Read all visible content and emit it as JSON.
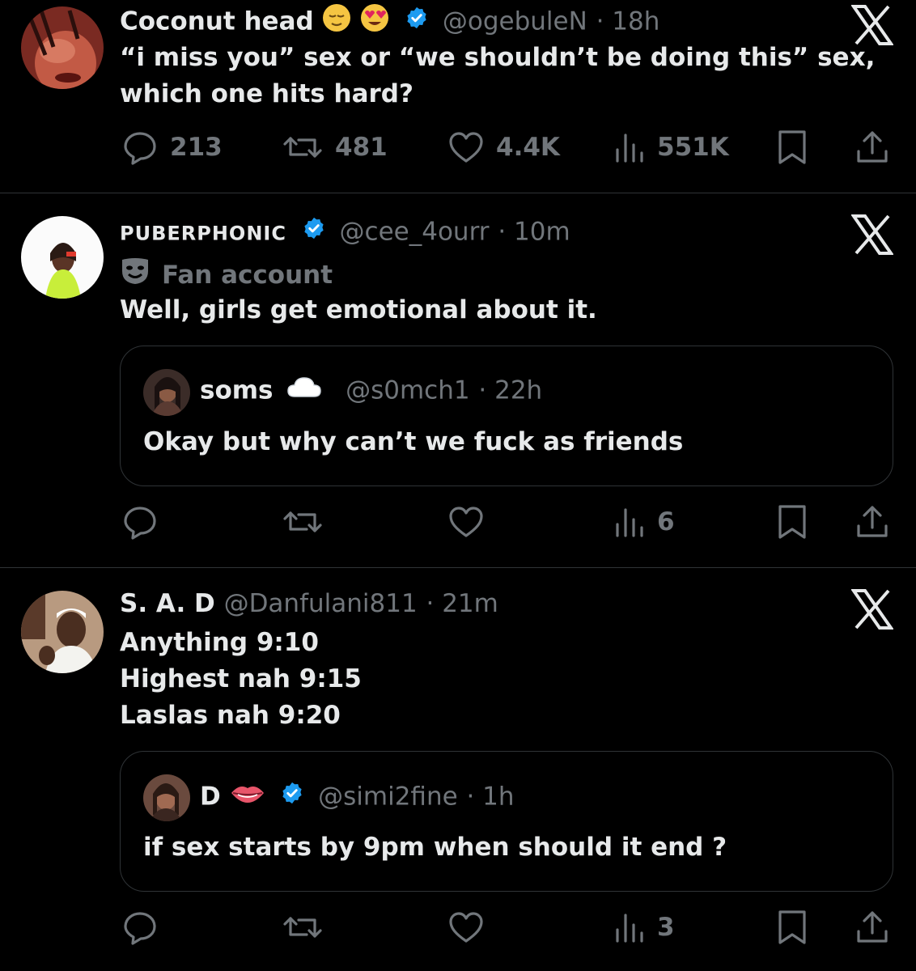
{
  "tweets": [
    {
      "name": "Coconut head",
      "handle": "@ogebuleN",
      "time": "· 18h",
      "lines": [
        "“i miss you” sex or “we shouldn’t be doing this” sex,",
        "which one hits hard?"
      ],
      "replies": "213",
      "retweets": "481",
      "likes": "4.4K",
      "views": "551K"
    },
    {
      "name": "PUBERPHONIC",
      "handle": "@cee_4ourr",
      "time": "· 10m",
      "label": "Fan account",
      "lines": [
        "Well, girls get emotional about it."
      ],
      "quote": {
        "name": "soms",
        "handle": "@s0mch1",
        "time": "· 22h",
        "text": "Okay but why can’t we fuck as friends"
      },
      "views": "6"
    },
    {
      "name": "S. A. D",
      "handle": "@Danfulani811",
      "time": "· 21m",
      "lines": [
        "Anything 9:10",
        "Highest nah 9:15",
        "Laslas nah 9:20"
      ],
      "quote": {
        "name": "D",
        "handle": "@simi2fine",
        "time": "· 1h",
        "text": "if sex starts by 9pm when should it end ?"
      },
      "views": "3"
    }
  ],
  "colors": {
    "background": "#000000",
    "text": "#e7e9ea",
    "secondary": "#71767b",
    "verified": "#1d9bf0",
    "divider": "#2f3336"
  }
}
